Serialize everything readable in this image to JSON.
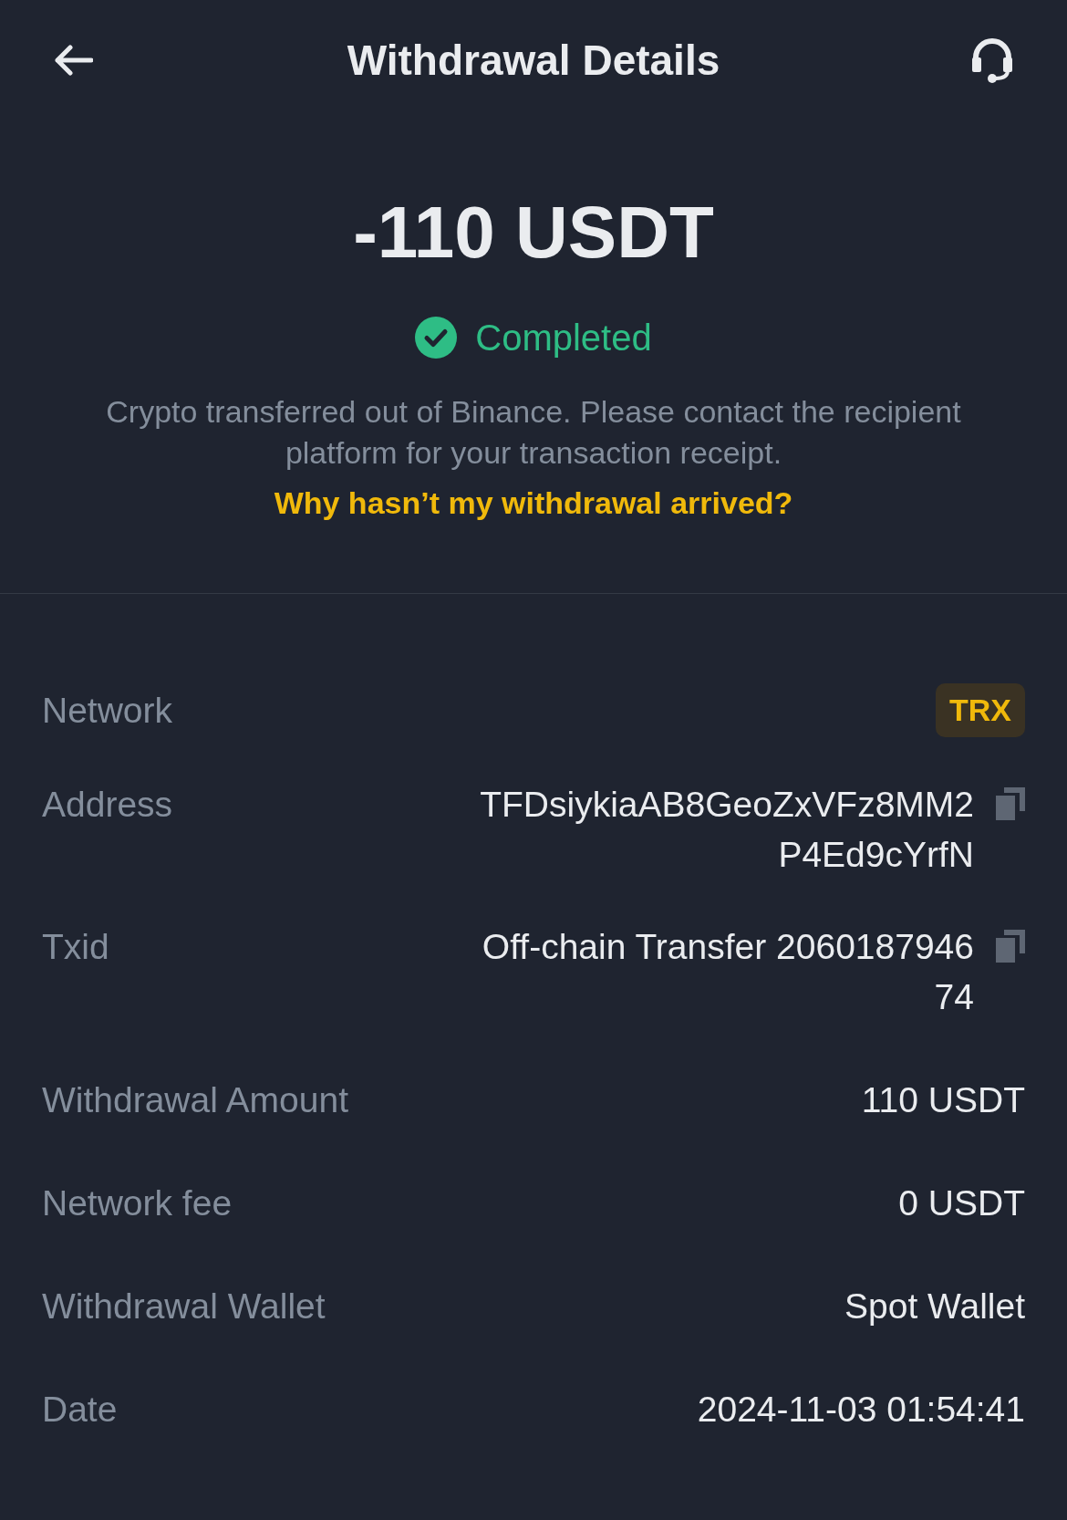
{
  "header": {
    "title": "Withdrawal Details"
  },
  "summary": {
    "amount": "-110 USDT",
    "status": {
      "label": "Completed",
      "kind": "completed"
    },
    "note": "Crypto transferred out of Binance. Please contact the recipient platform for your transaction receipt.",
    "help_link": "Why hasn’t my withdrawal arrived?"
  },
  "details": [
    {
      "label": "Network",
      "kind": "badge",
      "value": "TRX"
    },
    {
      "label": "Address",
      "kind": "copyable",
      "value": "TFDsiykiaAB8GeoZxVFz8MM2P4Ed9cYrfN"
    },
    {
      "label": "Txid",
      "kind": "copyable",
      "value": "Off-chain Transfer 206018794674"
    },
    {
      "label": "Withdrawal Amount",
      "kind": "text",
      "value": "110 USDT"
    },
    {
      "label": "Network fee",
      "kind": "text",
      "value": "0 USDT"
    },
    {
      "label": "Withdrawal Wallet",
      "kind": "text",
      "value": "Spot Wallet"
    },
    {
      "label": "Date",
      "kind": "text",
      "value": "2024-11-03 01:54:41"
    }
  ]
}
